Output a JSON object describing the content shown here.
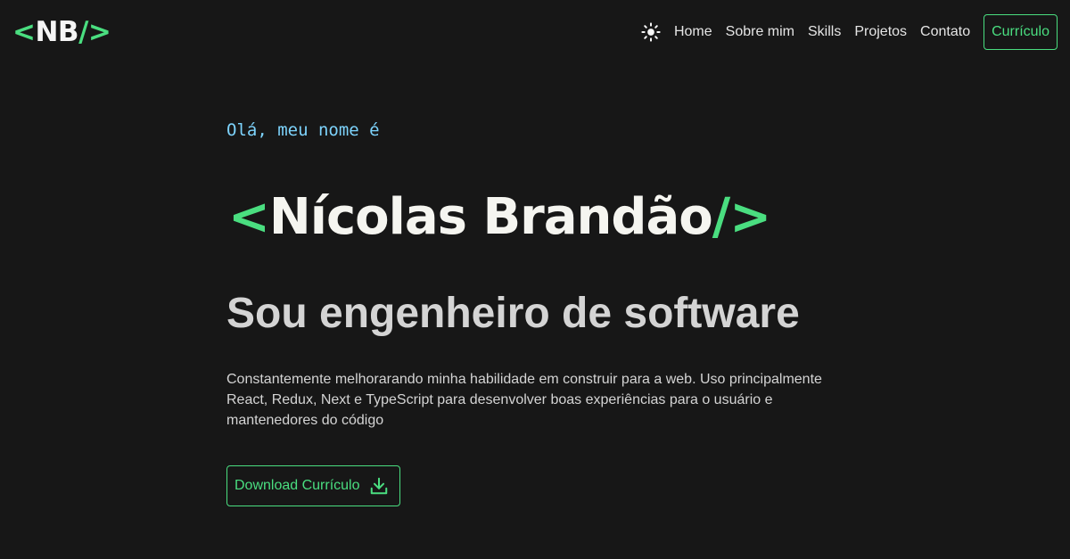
{
  "header": {
    "logo": {
      "open": "<",
      "initials": "NB",
      "close": "/>"
    },
    "theme_icon": "sun-icon",
    "nav": [
      {
        "label": "Home"
      },
      {
        "label": "Sobre mim"
      },
      {
        "label": "Skills"
      },
      {
        "label": "Projetos"
      },
      {
        "label": "Contato"
      }
    ],
    "cv_button": "Currículo"
  },
  "hero": {
    "greeting": "Olá, meu nome é",
    "name": {
      "open": "<",
      "text": "Nícolas Brandão",
      "close": "/>"
    },
    "role": "Sou engenheiro de software",
    "description": "Constantemente melhorarando minha habilidade em construir para a web. Uso principalmente React, Redux, Next e TypeScript para desenvolver boas experiências para o usuário e mantenedores do código",
    "download_button": {
      "label": "Download Currículo",
      "icon": "download-icon"
    }
  },
  "colors": {
    "background": "#171717",
    "accent": "#4ade80",
    "greeting": "#7dd3fc",
    "text": "#e5e5e5"
  }
}
